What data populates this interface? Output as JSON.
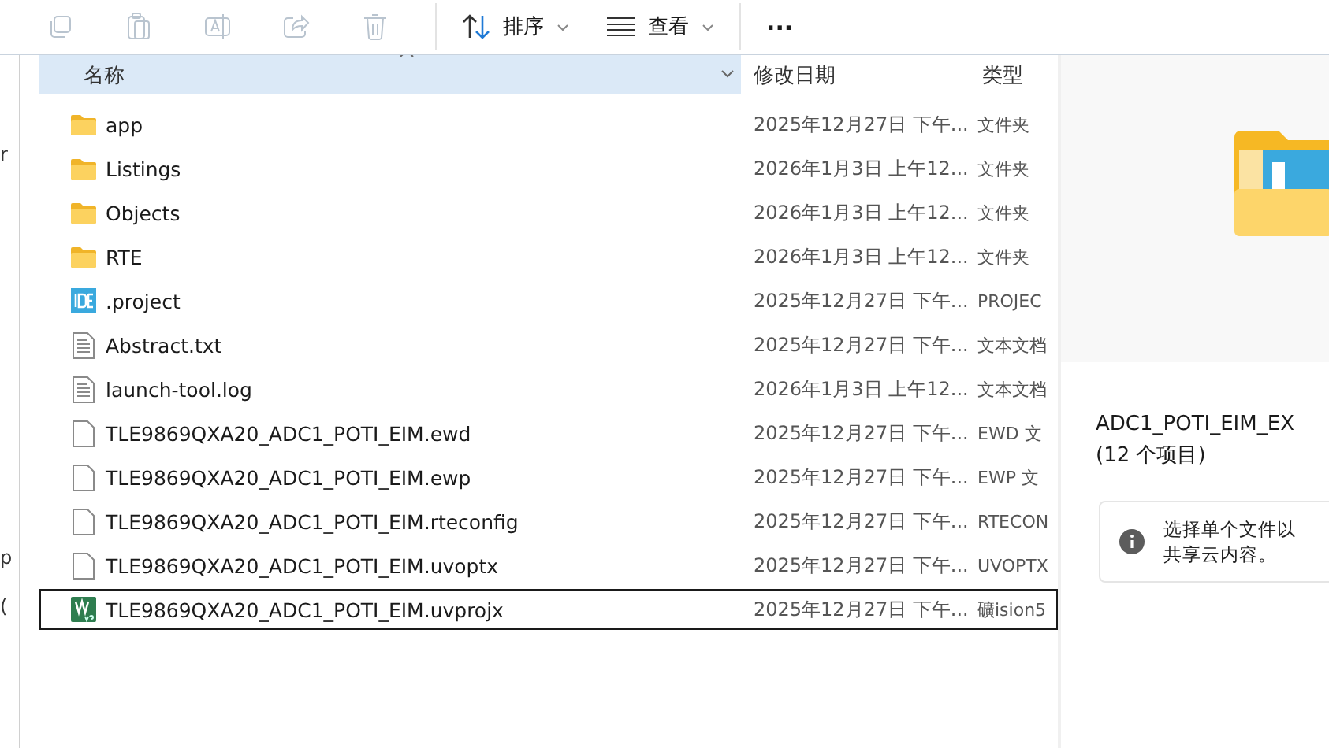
{
  "toolbar": {
    "icon_buttons": [
      {
        "kind": "copy",
        "disabled": true
      },
      {
        "kind": "paste",
        "disabled": true
      },
      {
        "kind": "rename",
        "disabled": true
      },
      {
        "kind": "share",
        "disabled": true
      },
      {
        "kind": "delete",
        "disabled": true
      }
    ],
    "sort_button": {
      "label": "排序"
    },
    "view_button": {
      "label": "查看"
    },
    "more_button": {
      "label": "..."
    }
  },
  "sidebar_fragments": [
    "r",
    "p",
    "("
  ],
  "table": {
    "columns": [
      {
        "label": "名称",
        "sorted": true
      },
      {
        "label": "修改日期",
        "sorted": false
      },
      {
        "label": "类型",
        "sorted": false
      }
    ],
    "rows": [
      {
        "kind": "folder",
        "name": "app",
        "date": "2025年12月27日 下午...",
        "type": "文件夹",
        "selected": false
      },
      {
        "kind": "folder",
        "name": "Listings",
        "date": "2026年1月3日 上午12...",
        "type": "文件夹",
        "selected": false
      },
      {
        "kind": "folder",
        "name": "Objects",
        "date": "2026年1月3日 上午12...",
        "type": "文件夹",
        "selected": false
      },
      {
        "kind": "folder",
        "name": "RTE",
        "date": "2026年1月3日 上午12...",
        "type": "文件夹",
        "selected": false
      },
      {
        "kind": "ide",
        "name": ".project",
        "date": "2025年12月27日 下午...",
        "type": "PROJEC",
        "selected": false
      },
      {
        "kind": "text",
        "name": "Abstract.txt",
        "date": "2025年12月27日 下午...",
        "type": "文本文档",
        "selected": false
      },
      {
        "kind": "text",
        "name": "launch-tool.log",
        "date": "2026年1月3日 上午12...",
        "type": "文本文档",
        "selected": false
      },
      {
        "kind": "file",
        "name": "TLE9869QXA20_ADC1_POTI_EIM.ewd",
        "date": "2025年12月27日 下午...",
        "type": "EWD 文",
        "selected": false
      },
      {
        "kind": "file",
        "name": "TLE9869QXA20_ADC1_POTI_EIM.ewp",
        "date": "2025年12月27日 下午...",
        "type": "EWP 文",
        "selected": false
      },
      {
        "kind": "file",
        "name": "TLE9869QXA20_ADC1_POTI_EIM.rteconfig",
        "date": "2025年12月27日 下午...",
        "type": "RTECON",
        "selected": false
      },
      {
        "kind": "file",
        "name": "TLE9869QXA20_ADC1_POTI_EIM.uvoptx",
        "date": "2025年12月27日 下午...",
        "type": "UVOPTX",
        "selected": false
      },
      {
        "kind": "uvision",
        "name": "TLE9869QXA20_ADC1_POTI_EIM.uvprojx",
        "date": "2025年12月27日 下午...",
        "type": "礦ision5",
        "selected": true
      }
    ]
  },
  "preview": {
    "title": "ADC1_POTI_EIM_EX",
    "count": "(12 个项目)",
    "info": [
      "选择单个文件以",
      "共享云内容。"
    ]
  }
}
